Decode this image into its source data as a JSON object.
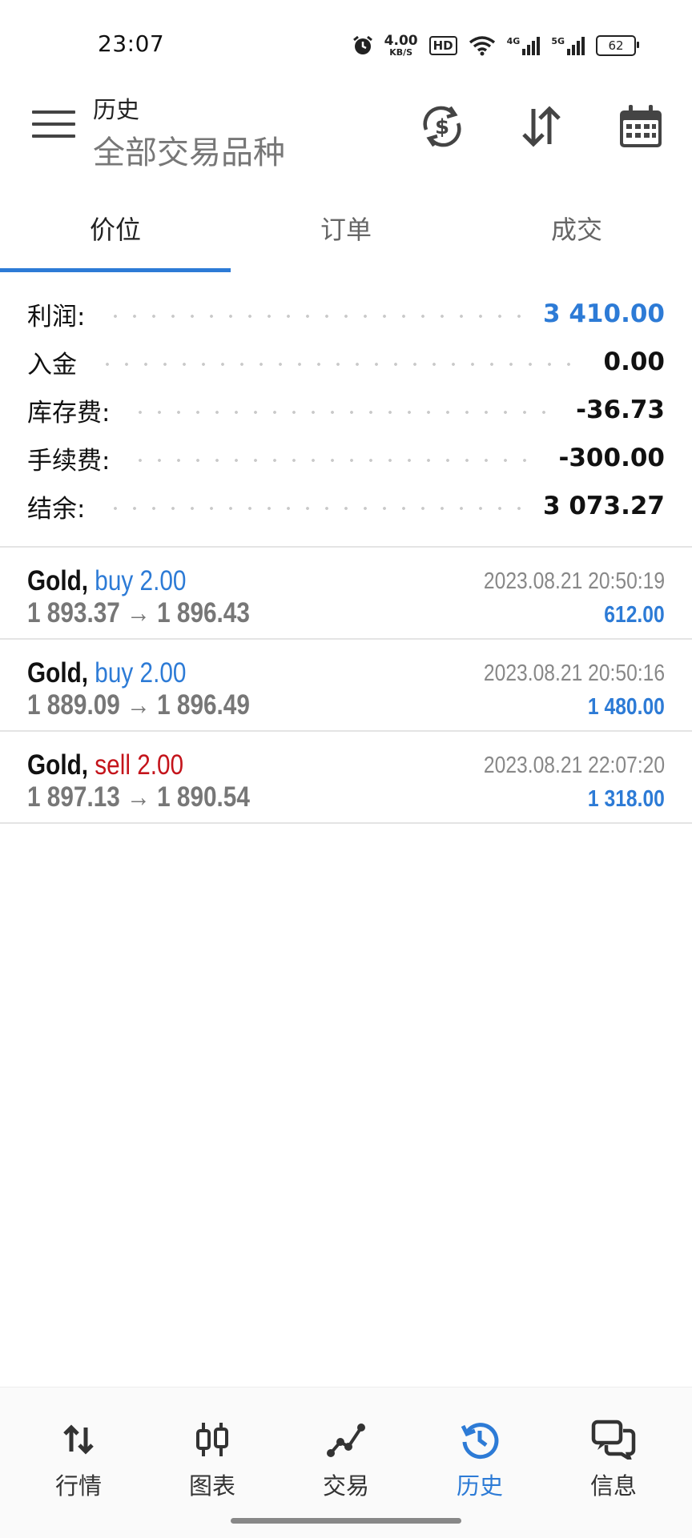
{
  "status_bar": {
    "time": "23:07",
    "net_speed_value": "4.00",
    "net_speed_unit": "KB/S",
    "hd_label": "HD",
    "net1": "4G",
    "net2": "5G",
    "battery": "62"
  },
  "header": {
    "title": "历史",
    "subtitle": "全部交易品种"
  },
  "tabs": [
    {
      "label": "价位",
      "active": true
    },
    {
      "label": "订单",
      "active": false
    },
    {
      "label": "成交",
      "active": false
    }
  ],
  "summary": [
    {
      "label": "利润:",
      "value": "3 410.00"
    },
    {
      "label": "入金",
      "value": "0.00"
    },
    {
      "label": "库存费:",
      "value": "-36.73"
    },
    {
      "label": "手续费:",
      "value": "-300.00"
    },
    {
      "label": "结余:",
      "value": "3 073.27"
    }
  ],
  "deals": [
    {
      "symbol": "Gold,",
      "type": "buy 2.00",
      "prices": "1 893.37 → 1 896.43",
      "time": "2023.08.21 20:50:19",
      "profit": "612.00"
    },
    {
      "symbol": "Gold,",
      "type": "buy 2.00",
      "prices": "1 889.09 → 1 896.49",
      "time": "2023.08.21 20:50:16",
      "profit": "1 480.00"
    },
    {
      "symbol": "Gold,",
      "type": "sell 2.00",
      "prices": "1 897.13 → 1 890.54",
      "time": "2023.08.21 22:07:20",
      "profit": "1 318.00"
    }
  ],
  "nav": [
    {
      "label": "行情",
      "icon": "quotes-arrows-icon"
    },
    {
      "label": "图表",
      "icon": "candlestick-chart-icon"
    },
    {
      "label": "交易",
      "icon": "trade-line-icon"
    },
    {
      "label": "历史",
      "icon": "history-clock-icon",
      "active": true
    },
    {
      "label": "信息",
      "icon": "messages-chat-icon"
    }
  ],
  "colors": {
    "accent": "#2d7bd6",
    "sell": "#c4141b",
    "muted": "#777777"
  }
}
